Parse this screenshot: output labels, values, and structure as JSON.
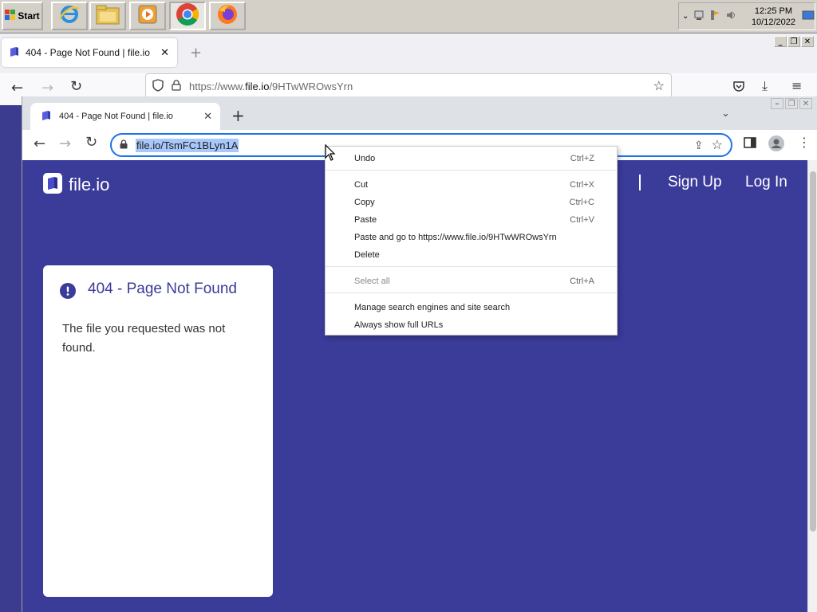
{
  "taskbar": {
    "start_label": "Start",
    "apps": [
      {
        "name": "Internet Explorer",
        "icon": "ie-icon"
      },
      {
        "name": "File Explorer",
        "icon": "folder-icon"
      },
      {
        "name": "Media Player",
        "icon": "media-player-icon"
      },
      {
        "name": "Google Chrome",
        "icon": "chrome-icon"
      },
      {
        "name": "Firefox",
        "icon": "firefox-icon"
      }
    ],
    "clock_time": "12:25 PM",
    "clock_date": "10/12/2022"
  },
  "firefox": {
    "tab_title": "404 - Page Not Found | file.io",
    "url_prefix": "https://www.",
    "url_domain": "file.io",
    "url_path": "/9HTwWROwsYrn"
  },
  "chrome": {
    "tab_title": "404 - Page Not Found | file.io",
    "url": "file.io/TsmFC1BLyn1A"
  },
  "site": {
    "logo_text": "file.io",
    "nav_sign_up": "Sign Up",
    "nav_log_in": "Log In",
    "error_title": "404 - Page Not Found",
    "error_message": "The file you requested was not found."
  },
  "context_menu": {
    "items": [
      {
        "label": "Undo",
        "shortcut": "Ctrl+Z",
        "disabled": false
      },
      {
        "label": "Cut",
        "shortcut": "Ctrl+X",
        "disabled": false
      },
      {
        "label": "Copy",
        "shortcut": "Ctrl+C",
        "disabled": false
      },
      {
        "label": "Paste",
        "shortcut": "Ctrl+V",
        "disabled": false
      },
      {
        "label": "Paste and go to https://www.file.io/9HTwWROwsYrn",
        "shortcut": "",
        "disabled": false
      },
      {
        "label": "Delete",
        "shortcut": "",
        "disabled": false
      },
      {
        "label": "Select all",
        "shortcut": "Ctrl+A",
        "disabled": true
      },
      {
        "label": "Manage search engines and site search",
        "shortcut": "",
        "disabled": false
      },
      {
        "label": "Always show full URLs",
        "shortcut": "",
        "disabled": false
      }
    ]
  },
  "colors": {
    "site_bg": "#3b3b9a",
    "chrome_accent": "#1a73e8",
    "selection": "#a8c7fa"
  }
}
